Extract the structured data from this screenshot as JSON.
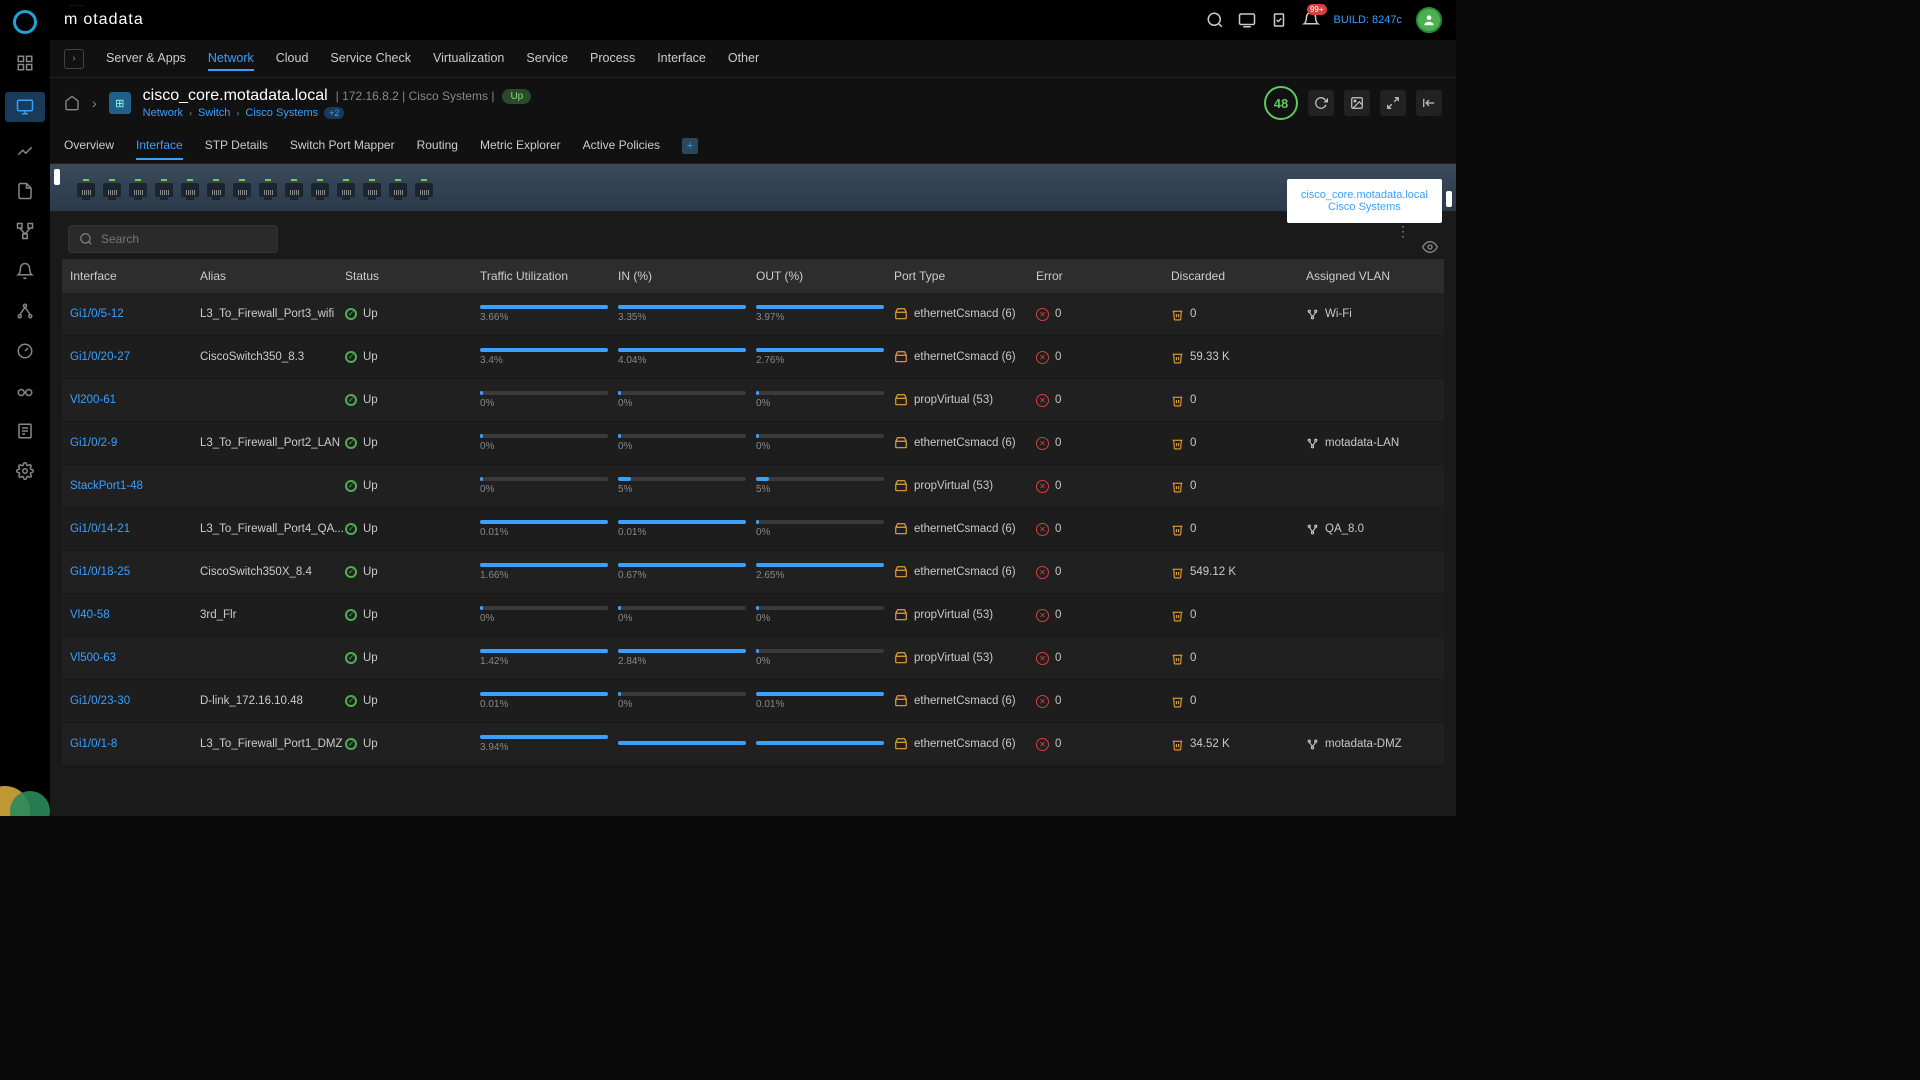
{
  "brand": "motadata",
  "build_label": "BUILD: 8247c",
  "notification_badge": "99+",
  "top_tabs": [
    "Server & Apps",
    "Network",
    "Cloud",
    "Service Check",
    "Virtualization",
    "Service",
    "Process",
    "Interface",
    "Other"
  ],
  "top_tabs_active": 1,
  "title": {
    "name": "cisco_core.motadata.local",
    "ip": "172.16.8.2",
    "vendor": "Cisco Systems",
    "status": "Up",
    "breadcrumb": [
      "Network",
      "Switch",
      "Cisco Systems"
    ],
    "extra_chip": "+2",
    "score": "48"
  },
  "sub_tabs": [
    "Overview",
    "Interface",
    "STP Details",
    "Switch Port Mapper",
    "Routing",
    "Metric Explorer",
    "Active Policies"
  ],
  "sub_tabs_active": 1,
  "switch_label": {
    "line1": "cisco_core.motadata.local",
    "line2": "Cisco Systems"
  },
  "search_placeholder": "Search",
  "columns": [
    "Interface",
    "Alias",
    "Status",
    "Traffic Utilization",
    "IN (%)",
    "OUT (%)",
    "Port Type",
    "Error",
    "Discarded",
    "Assigned VLAN"
  ],
  "rows": [
    {
      "iface": "Gi1/0/5-12",
      "alias": "L3_To_Firewall_Port3_wifi",
      "status": "Up",
      "traffic": "3.66%",
      "traffic_p": 100,
      "in": "3.35%",
      "in_p": 100,
      "out": "3.97%",
      "out_p": 100,
      "port": "ethernetCsmacd (6)",
      "err": "0",
      "disc": "0",
      "vlan": "Wi-Fi"
    },
    {
      "iface": "Gi1/0/20-27",
      "alias": "CiscoSwitch350_8.3",
      "status": "Up",
      "traffic": "3.4%",
      "traffic_p": 100,
      "in": "4.04%",
      "in_p": 100,
      "out": "2.76%",
      "out_p": 100,
      "port": "ethernetCsmacd (6)",
      "err": "0",
      "disc": "59.33 K",
      "vlan": ""
    },
    {
      "iface": "Vl200-61",
      "alias": "",
      "status": "Up",
      "traffic": "0%",
      "traffic_p": 2,
      "in": "0%",
      "in_p": 2,
      "out": "0%",
      "out_p": 2,
      "port": "propVirtual (53)",
      "err": "0",
      "disc": "0",
      "vlan": ""
    },
    {
      "iface": "Gi1/0/2-9",
      "alias": "L3_To_Firewall_Port2_LAN",
      "status": "Up",
      "traffic": "0%",
      "traffic_p": 2,
      "in": "0%",
      "in_p": 2,
      "out": "0%",
      "out_p": 2,
      "port": "ethernetCsmacd (6)",
      "err": "0",
      "disc": "0",
      "vlan": "motadata-LAN"
    },
    {
      "iface": "StackPort1-48",
      "alias": "",
      "status": "Up",
      "traffic": "0%",
      "traffic_p": 2,
      "in": "5%",
      "in_p": 10,
      "out": "5%",
      "out_p": 10,
      "port": "propVirtual (53)",
      "err": "0",
      "disc": "0",
      "vlan": ""
    },
    {
      "iface": "Gi1/0/14-21",
      "alias": "L3_To_Firewall_Port4_QA...",
      "status": "Up",
      "traffic": "0.01%",
      "traffic_p": 100,
      "in": "0.01%",
      "in_p": 100,
      "out": "0%",
      "out_p": 2,
      "port": "ethernetCsmacd (6)",
      "err": "0",
      "disc": "0",
      "vlan": "QA_8.0"
    },
    {
      "iface": "Gi1/0/18-25",
      "alias": "CiscoSwitch350X_8.4",
      "status": "Up",
      "traffic": "1.66%",
      "traffic_p": 100,
      "in": "0.67%",
      "in_p": 100,
      "out": "2.65%",
      "out_p": 100,
      "port": "ethernetCsmacd (6)",
      "err": "0",
      "disc": "549.12 K",
      "vlan": ""
    },
    {
      "iface": "Vl40-58",
      "alias": "3rd_Flr",
      "status": "Up",
      "traffic": "0%",
      "traffic_p": 2,
      "in": "0%",
      "in_p": 2,
      "out": "0%",
      "out_p": 2,
      "port": "propVirtual (53)",
      "err": "0",
      "disc": "0",
      "vlan": ""
    },
    {
      "iface": "Vl500-63",
      "alias": "",
      "status": "Up",
      "traffic": "1.42%",
      "traffic_p": 100,
      "in": "2.84%",
      "in_p": 100,
      "out": "0%",
      "out_p": 2,
      "port": "propVirtual (53)",
      "err": "0",
      "disc": "0",
      "vlan": ""
    },
    {
      "iface": "Gi1/0/23-30",
      "alias": "D-link_172.16.10.48",
      "status": "Up",
      "traffic": "0.01%",
      "traffic_p": 100,
      "in": "0%",
      "in_p": 2,
      "out": "0.01%",
      "out_p": 100,
      "port": "ethernetCsmacd (6)",
      "err": "0",
      "disc": "0",
      "vlan": ""
    },
    {
      "iface": "Gi1/0/1-8",
      "alias": "L3_To_Firewall_Port1_DMZ",
      "status": "Up",
      "traffic": "3.94%",
      "traffic_p": 100,
      "in": "",
      "in_p": 100,
      "out": "",
      "out_p": 100,
      "port": "ethernetCsmacd (6)",
      "err": "0",
      "disc": "34.52 K",
      "vlan": "motadata-DMZ"
    }
  ],
  "port_count": 14
}
